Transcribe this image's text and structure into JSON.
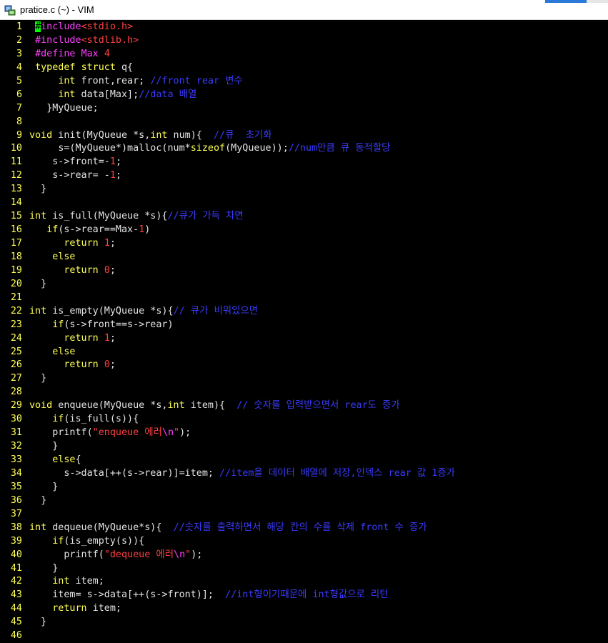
{
  "window": {
    "title": "pratice.c (~) - VIM",
    "icon": "vim-app-icon"
  },
  "colors": {
    "line_number": "#ffff54",
    "keyword": "#ffff54",
    "preprocessor": "#ff40ff",
    "string_number": "#ff4040",
    "comment": "#3b3bff",
    "text": "#e4e4e4",
    "cursor": "#00ff00"
  },
  "editor": {
    "lines": [
      {
        "n": "1",
        "tokens": [
          {
            "t": "#",
            "c": "cursor"
          },
          {
            "t": "include",
            "c": "pp"
          },
          {
            "t": "<stdio.h>",
            "c": "str"
          }
        ],
        "indent": " "
      },
      {
        "n": "2",
        "tokens": [
          {
            "t": "#include",
            "c": "pp"
          },
          {
            "t": "<stdlib.h>",
            "c": "str"
          }
        ],
        "indent": " "
      },
      {
        "n": "3",
        "tokens": [
          {
            "t": "#define",
            "c": "pp"
          },
          {
            "t": " Max ",
            "c": "pp"
          },
          {
            "t": "4",
            "c": "str"
          }
        ],
        "indent": " "
      },
      {
        "n": "4",
        "tokens": [
          {
            "t": "typedef",
            "c": "kw"
          },
          {
            "t": " ",
            "c": "def"
          },
          {
            "t": "struct",
            "c": "kw"
          },
          {
            "t": " q{",
            "c": "def"
          }
        ],
        "indent": " "
      },
      {
        "n": "5",
        "tokens": [
          {
            "t": "int",
            "c": "kw"
          },
          {
            "t": " front,rear; ",
            "c": "def"
          },
          {
            "t": "//front rear 변수",
            "c": "com"
          }
        ],
        "indent": "     "
      },
      {
        "n": "6",
        "tokens": [
          {
            "t": "int",
            "c": "kw"
          },
          {
            "t": " data[Max];",
            "c": "def"
          },
          {
            "t": "//data 배열",
            "c": "com"
          }
        ],
        "indent": "     "
      },
      {
        "n": "7",
        "tokens": [
          {
            "t": "}MyQueue;",
            "c": "def"
          }
        ],
        "indent": "   "
      },
      {
        "n": "8",
        "tokens": [],
        "indent": ""
      },
      {
        "n": "9",
        "tokens": [
          {
            "t": "void",
            "c": "kw"
          },
          {
            "t": " init(MyQueue *s,",
            "c": "def"
          },
          {
            "t": "int",
            "c": "kw"
          },
          {
            "t": " num){  ",
            "c": "def"
          },
          {
            "t": "//큐  초기화",
            "c": "com"
          }
        ],
        "indent": ""
      },
      {
        "n": "10",
        "tokens": [
          {
            "t": "s=(MyQueue*)malloc(num*",
            "c": "def"
          },
          {
            "t": "sizeof",
            "c": "kw"
          },
          {
            "t": "(MyQueue));",
            "c": "def"
          },
          {
            "t": "//num만큼 큐 동적할당",
            "c": "com"
          }
        ],
        "indent": "     "
      },
      {
        "n": "11",
        "tokens": [
          {
            "t": "s->front=-",
            "c": "def"
          },
          {
            "t": "1",
            "c": "str"
          },
          {
            "t": ";",
            "c": "def"
          }
        ],
        "indent": "    "
      },
      {
        "n": "12",
        "tokens": [
          {
            "t": "s->rear= -",
            "c": "def"
          },
          {
            "t": "1",
            "c": "str"
          },
          {
            "t": ";",
            "c": "def"
          }
        ],
        "indent": "    "
      },
      {
        "n": "13",
        "tokens": [
          {
            "t": "}",
            "c": "def"
          }
        ],
        "indent": "  "
      },
      {
        "n": "14",
        "tokens": [],
        "indent": ""
      },
      {
        "n": "15",
        "tokens": [
          {
            "t": "int",
            "c": "kw"
          },
          {
            "t": " is_full(MyQueue *s){",
            "c": "def"
          },
          {
            "t": "//큐가 가득 차면",
            "c": "com"
          }
        ],
        "indent": ""
      },
      {
        "n": "16",
        "tokens": [
          {
            "t": "if",
            "c": "kw"
          },
          {
            "t": "(s->rear==Max-",
            "c": "def"
          },
          {
            "t": "1",
            "c": "str"
          },
          {
            "t": ")",
            "c": "def"
          }
        ],
        "indent": "   "
      },
      {
        "n": "17",
        "tokens": [
          {
            "t": "return",
            "c": "kw"
          },
          {
            "t": " ",
            "c": "def"
          },
          {
            "t": "1",
            "c": "str"
          },
          {
            "t": ";",
            "c": "def"
          }
        ],
        "indent": "      "
      },
      {
        "n": "18",
        "tokens": [
          {
            "t": "else",
            "c": "kw"
          }
        ],
        "indent": "    "
      },
      {
        "n": "19",
        "tokens": [
          {
            "t": "return",
            "c": "kw"
          },
          {
            "t": " ",
            "c": "def"
          },
          {
            "t": "0",
            "c": "str"
          },
          {
            "t": ";",
            "c": "def"
          }
        ],
        "indent": "      "
      },
      {
        "n": "20",
        "tokens": [
          {
            "t": "}",
            "c": "def"
          }
        ],
        "indent": "  "
      },
      {
        "n": "21",
        "tokens": [],
        "indent": ""
      },
      {
        "n": "22",
        "tokens": [
          {
            "t": "int",
            "c": "kw"
          },
          {
            "t": " is_empty(MyQueue *s){",
            "c": "def"
          },
          {
            "t": "// 큐가 비워있으면",
            "c": "com"
          }
        ],
        "indent": ""
      },
      {
        "n": "23",
        "tokens": [
          {
            "t": "if",
            "c": "kw"
          },
          {
            "t": "(s->front==s->rear)",
            "c": "def"
          }
        ],
        "indent": "    "
      },
      {
        "n": "24",
        "tokens": [
          {
            "t": "return",
            "c": "kw"
          },
          {
            "t": " ",
            "c": "def"
          },
          {
            "t": "1",
            "c": "str"
          },
          {
            "t": ";",
            "c": "def"
          }
        ],
        "indent": "      "
      },
      {
        "n": "25",
        "tokens": [
          {
            "t": "else",
            "c": "kw"
          }
        ],
        "indent": "    "
      },
      {
        "n": "26",
        "tokens": [
          {
            "t": "return",
            "c": "kw"
          },
          {
            "t": " ",
            "c": "def"
          },
          {
            "t": "0",
            "c": "str"
          },
          {
            "t": ";",
            "c": "def"
          }
        ],
        "indent": "      "
      },
      {
        "n": "27",
        "tokens": [
          {
            "t": "}",
            "c": "def"
          }
        ],
        "indent": "  "
      },
      {
        "n": "28",
        "tokens": [],
        "indent": ""
      },
      {
        "n": "29",
        "tokens": [
          {
            "t": "void",
            "c": "kw"
          },
          {
            "t": " enqueue(MyQueue *s,",
            "c": "def"
          },
          {
            "t": "int",
            "c": "kw"
          },
          {
            "t": " item){  ",
            "c": "def"
          },
          {
            "t": "// 숫자를 입력받으면서 rear도 증가",
            "c": "com"
          }
        ],
        "indent": ""
      },
      {
        "n": "30",
        "tokens": [
          {
            "t": "if",
            "c": "kw"
          },
          {
            "t": "(is_full(s)){",
            "c": "def"
          }
        ],
        "indent": "    "
      },
      {
        "n": "31",
        "tokens": [
          {
            "t": "printf(",
            "c": "def"
          },
          {
            "t": "\"enqueue 에러",
            "c": "str"
          },
          {
            "t": "\\n",
            "c": "pp"
          },
          {
            "t": "\"",
            "c": "str"
          },
          {
            "t": ");",
            "c": "def"
          }
        ],
        "indent": "    "
      },
      {
        "n": "32",
        "tokens": [
          {
            "t": "}",
            "c": "def"
          }
        ],
        "indent": "    "
      },
      {
        "n": "33",
        "tokens": [
          {
            "t": "else",
            "c": "kw"
          },
          {
            "t": "{",
            "c": "def"
          }
        ],
        "indent": "    "
      },
      {
        "n": "34",
        "tokens": [
          {
            "t": "s->data[++(s->rear)]=item; ",
            "c": "def"
          },
          {
            "t": "//item을 데이터 배열에 저장,인덱스 rear 값 1증가",
            "c": "com"
          }
        ],
        "indent": "      "
      },
      {
        "n": "35",
        "tokens": [
          {
            "t": "}",
            "c": "def"
          }
        ],
        "indent": "    "
      },
      {
        "n": "36",
        "tokens": [
          {
            "t": "}",
            "c": "def"
          }
        ],
        "indent": "  "
      },
      {
        "n": "37",
        "tokens": [],
        "indent": ""
      },
      {
        "n": "38",
        "tokens": [
          {
            "t": "int",
            "c": "kw"
          },
          {
            "t": " dequeue(MyQueue*s){  ",
            "c": "def"
          },
          {
            "t": "//숫자를 출력하면서 해당 칸의 수를 삭제 front 수 증가",
            "c": "com"
          }
        ],
        "indent": ""
      },
      {
        "n": "39",
        "tokens": [
          {
            "t": "if",
            "c": "kw"
          },
          {
            "t": "(is_empty(s)){",
            "c": "def"
          }
        ],
        "indent": "    "
      },
      {
        "n": "40",
        "tokens": [
          {
            "t": "printf(",
            "c": "def"
          },
          {
            "t": "\"dequeue 에러",
            "c": "str"
          },
          {
            "t": "\\n",
            "c": "pp"
          },
          {
            "t": "\"",
            "c": "str"
          },
          {
            "t": ");",
            "c": "def"
          }
        ],
        "indent": "      "
      },
      {
        "n": "41",
        "tokens": [
          {
            "t": "}",
            "c": "def"
          }
        ],
        "indent": "    "
      },
      {
        "n": "42",
        "tokens": [
          {
            "t": "int",
            "c": "kw"
          },
          {
            "t": " item;",
            "c": "def"
          }
        ],
        "indent": "    "
      },
      {
        "n": "43",
        "tokens": [
          {
            "t": "item= s->data[++(s->front)];  ",
            "c": "def"
          },
          {
            "t": "//int형이기때문에 int형값으로 리턴",
            "c": "com"
          }
        ],
        "indent": "    "
      },
      {
        "n": "44",
        "tokens": [
          {
            "t": "return",
            "c": "kw"
          },
          {
            "t": " item;",
            "c": "def"
          }
        ],
        "indent": "    "
      },
      {
        "n": "45",
        "tokens": [
          {
            "t": "}",
            "c": "def"
          }
        ],
        "indent": "  "
      },
      {
        "n": "46",
        "tokens": [],
        "indent": ""
      }
    ]
  }
}
